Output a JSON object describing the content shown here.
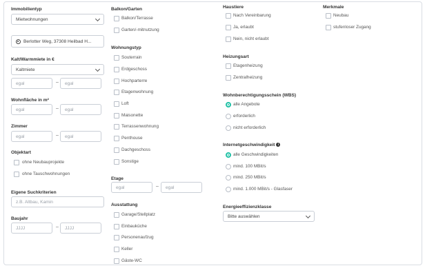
{
  "immobilientyp": {
    "heading": "Immobilientyp",
    "value": "Mietwohnungen"
  },
  "location": {
    "value": "Berlotter Weg, 37308 Heilbad H..."
  },
  "kaltmiete": {
    "heading": "Kalt/Warmmiete in €",
    "value": "Kaltmiete",
    "from_placeholder": "egal",
    "to_placeholder": "egal"
  },
  "wohnflaeche": {
    "heading": "Wohnfläche in m²",
    "from_placeholder": "egal",
    "to_placeholder": "egal"
  },
  "zimmer": {
    "heading": "Zimmer",
    "from_placeholder": "egal",
    "to_placeholder": "egal"
  },
  "objektart": {
    "heading": "Objektart",
    "options": [
      "ohne Neubauprojekte",
      "ohne Tauschwohnungen"
    ]
  },
  "suchkriterien": {
    "heading": "Eigene Suchkriterien",
    "placeholder": "z.B. Altbau, Kamin"
  },
  "baujahr": {
    "heading": "Baujahr",
    "from_placeholder": "JJJJ",
    "to_placeholder": "JJJJ"
  },
  "balkon": {
    "heading": "Balkon/Garten",
    "options": [
      "Balkon/Terrasse",
      "Garten/-mitnutzung"
    ]
  },
  "wohnungstyp": {
    "heading": "Wohnungstyp",
    "options": [
      "Souterrain",
      "Erdgeschoss",
      "Hochparterre",
      "Etagenwohnung",
      "Loft",
      "Maisonette",
      "Terrassenwohnung",
      "Penthouse",
      "Dachgeschoss",
      "Sonstige"
    ]
  },
  "etage": {
    "heading": "Etage",
    "from_placeholder": "egal",
    "to_placeholder": "egal"
  },
  "ausstattung": {
    "heading": "Ausstattung",
    "options": [
      "Garage/Stellplatz",
      "Einbauküche",
      "Personenaufzug",
      "Keller",
      "Gäste-WC"
    ]
  },
  "haustiere": {
    "heading": "Haustiere",
    "options": [
      "Nach Vereinbarung",
      "Ja, erlaubt",
      "Nein, nicht erlaubt"
    ]
  },
  "heizungsart": {
    "heading": "Heizungsart",
    "options": [
      "Etagenheizung",
      "Zentralheizung"
    ]
  },
  "wbs": {
    "heading": "Wohnberechtigungsschein (WBS)",
    "options": [
      "alle Angebote",
      "erforderlich",
      "nicht erforderlich"
    ],
    "selected": 0
  },
  "internet": {
    "heading": "Internetgeschwindigkeit",
    "options": [
      "alle Geschwindigkeiten",
      "mind. 100 MBit/s",
      "mind. 250 MBit/s",
      "mind. 1.000 MBit/s - Glasfaser"
    ],
    "selected": 0
  },
  "energie": {
    "heading": "Energieeffizienzklasse",
    "value": "Bitte auswählen"
  },
  "merkmale": {
    "heading": "Merkmale",
    "options": [
      "Neubau",
      "stufenloser Zugang"
    ]
  },
  "dash": "–",
  "colors": {
    "accent": "#21c1a6",
    "border": "#c9ced6"
  }
}
